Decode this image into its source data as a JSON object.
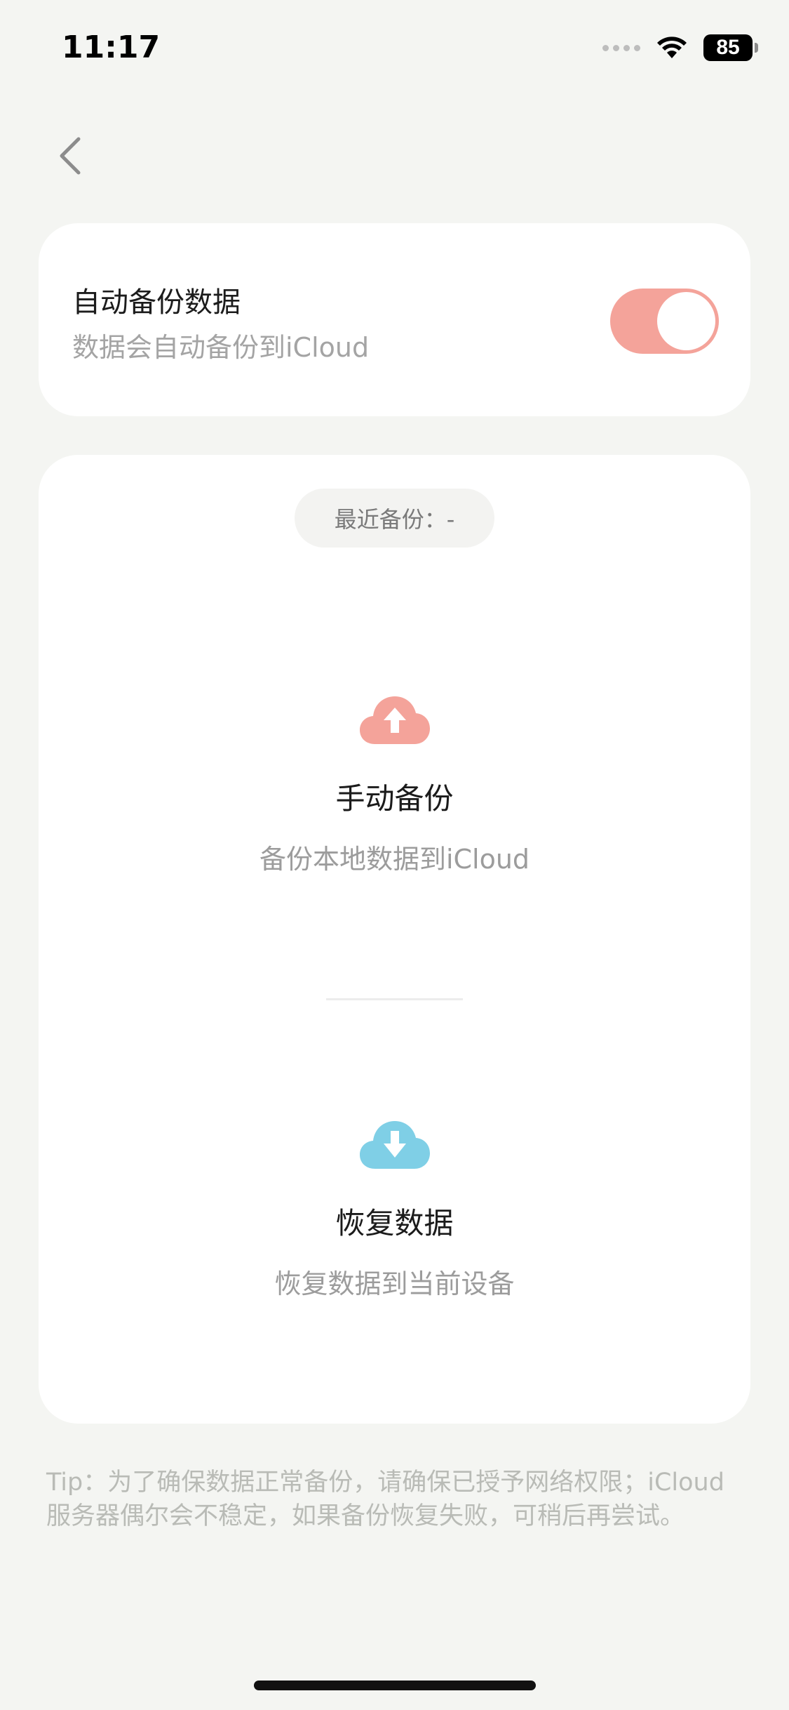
{
  "status_bar": {
    "time": "11:17",
    "battery": "85"
  },
  "auto_backup": {
    "title": "自动备份数据",
    "subtitle": "数据会自动备份到iCloud",
    "enabled": true
  },
  "recent_backup": {
    "label": "最近备份：-"
  },
  "manual_backup": {
    "title": "手动备份",
    "subtitle": "备份本地数据到iCloud"
  },
  "restore": {
    "title": "恢复数据",
    "subtitle": "恢复数据到当前设备"
  },
  "tip": {
    "text": "Tip：为了确保数据正常备份，请确保已授予网络权限；iCloud服务器偶尔会不稳定，如果备份恢复失败，可稍后再尝试。"
  },
  "colors": {
    "accent_pink": "#f4a39a",
    "accent_blue": "#7fcfe6",
    "background": "#f4f5f2"
  },
  "icons": {
    "back": "chevron-left-icon",
    "upload": "cloud-upload-icon",
    "download": "cloud-download-icon",
    "wifi": "wifi-icon"
  }
}
